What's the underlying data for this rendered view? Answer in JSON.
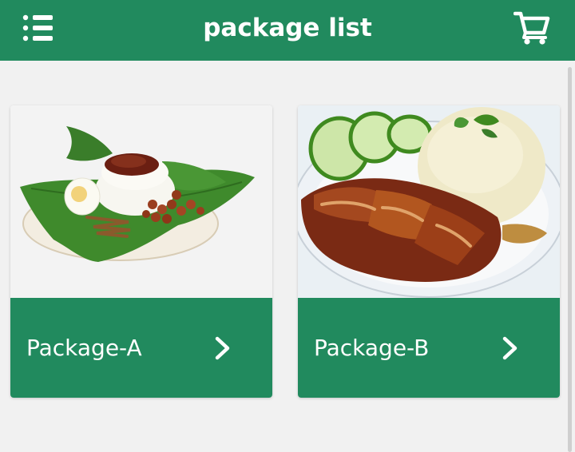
{
  "header": {
    "title": "package list",
    "menu_icon": "menu-list-icon",
    "cart_icon": "shopping-cart-icon"
  },
  "packages": [
    {
      "label": "Package-A",
      "image": "nasi-lemak-dish-photo",
      "arrow_icon": "chevron-right-icon"
    },
    {
      "label": "Package-B",
      "image": "roast-chicken-rice-dish-photo",
      "arrow_icon": "chevron-right-icon"
    }
  ],
  "colors": {
    "primary": "#218a5e",
    "background": "#f1f1f1",
    "text_on_primary": "#ffffff"
  }
}
